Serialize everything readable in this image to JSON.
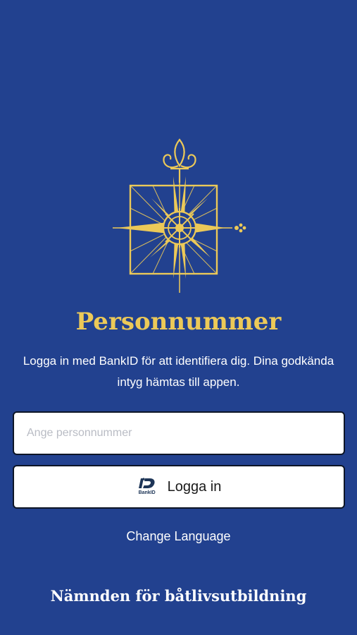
{
  "brand": {
    "logo_icon": "compass-rose-fleur-de-lis-helm-icon",
    "accent_color": "#ecc958",
    "background_color": "#22418f"
  },
  "title": "Personnummer",
  "description": "Logga in med BankID för att identifiera dig. Dina godkända intyg hämtas till appen.",
  "personnummer_input": {
    "value": "",
    "placeholder": "Ange personnummer"
  },
  "login_button": {
    "icon": "bankid-icon",
    "icon_text": "BankID",
    "label": "Logga in"
  },
  "change_language": "Change Language",
  "footer": "Nämnden för båtlivsutbildning"
}
